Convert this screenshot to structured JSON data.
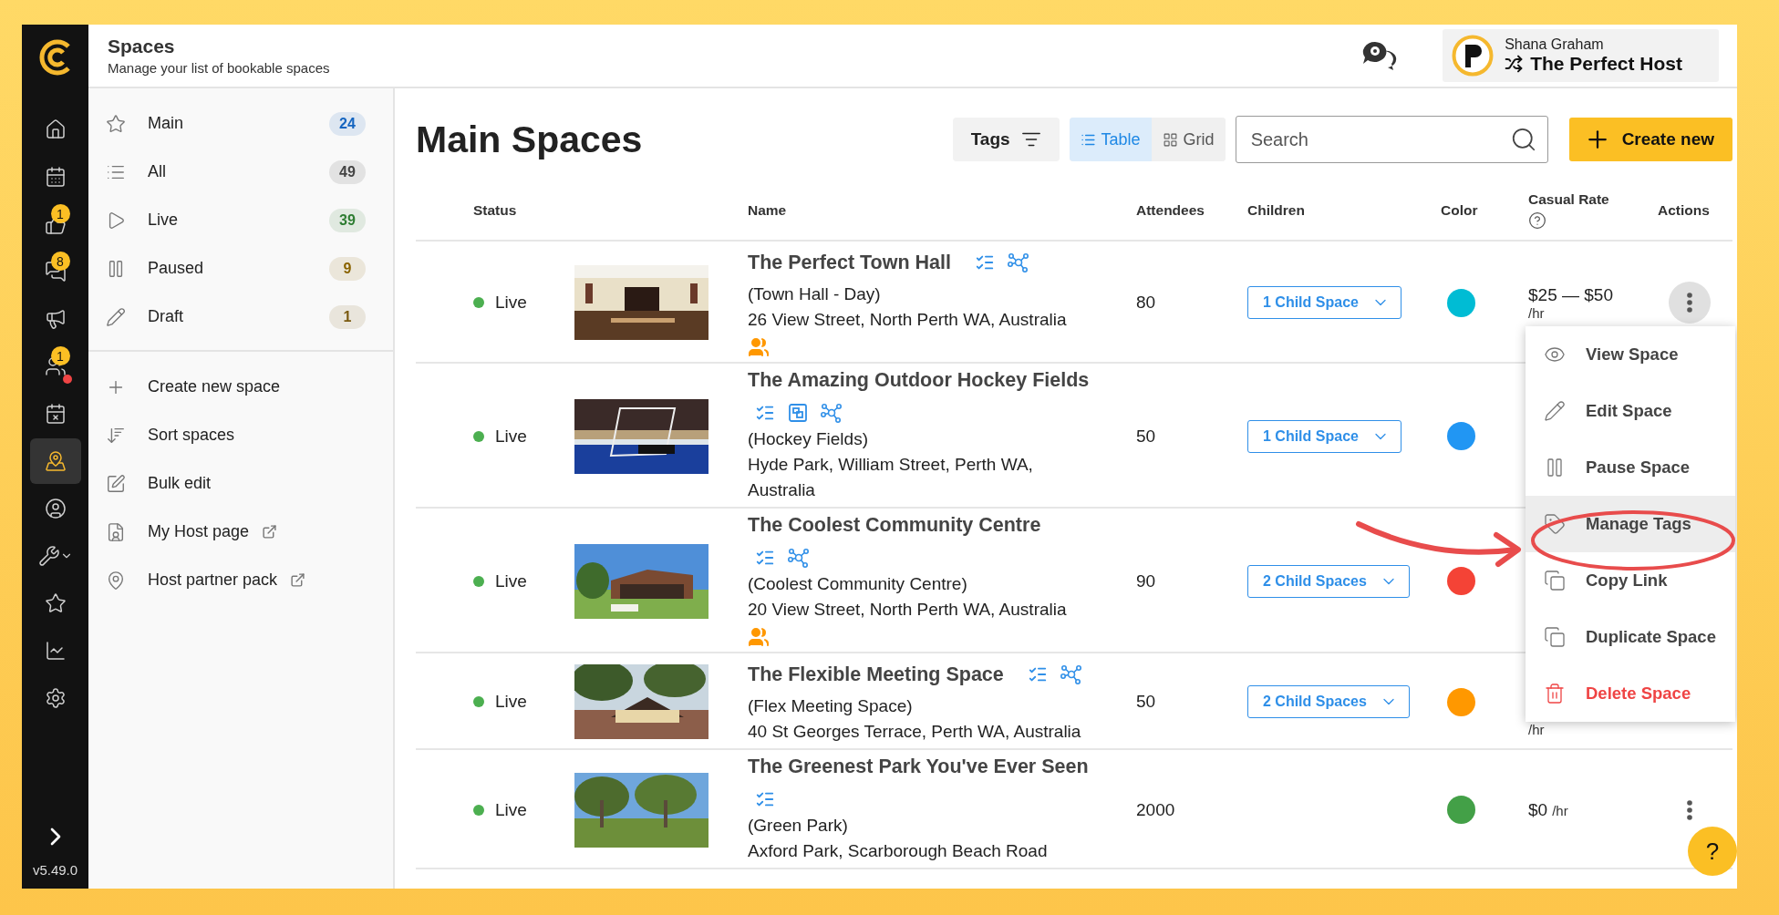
{
  "rail": {
    "items": [
      {
        "selected": false,
        "alert": false
      },
      {
        "selected": false,
        "alert": false
      },
      {
        "selected": false,
        "alert": false,
        "badge": "1"
      },
      {
        "selected": false,
        "alert": false,
        "badge": "8"
      },
      {
        "selected": false,
        "alert": false
      },
      {
        "selected": false,
        "alert": true,
        "badge": "1"
      },
      {
        "selected": false,
        "alert": false
      },
      {
        "selected": true,
        "alert": false
      },
      {
        "selected": false,
        "alert": false
      },
      {
        "selected": false,
        "alert": false
      },
      {
        "selected": false,
        "alert": false
      },
      {
        "selected": false,
        "alert": false
      },
      {
        "selected": false,
        "alert": false
      }
    ],
    "version": "v5.49.0"
  },
  "header": {
    "title": "Spaces",
    "subtitle": "Manage your list of bookable spaces",
    "user": {
      "name": "Shana Graham",
      "organisation": "The Perfect Host"
    }
  },
  "sidebar": {
    "views": [
      {
        "label": "Main",
        "count": "24",
        "color": "#1565c0"
      },
      {
        "label": "All",
        "count": "49",
        "color": "#444444"
      },
      {
        "label": "Live",
        "count": "39",
        "color": "#2e7d32"
      },
      {
        "label": "Paused",
        "count": "9",
        "color": "#8a6300"
      },
      {
        "label": "Draft",
        "count": "1",
        "color": "#7a5a10"
      }
    ],
    "actions": [
      {
        "label": "Create new space",
        "external": false
      },
      {
        "label": "Sort spaces",
        "external": false
      },
      {
        "label": "Bulk edit",
        "external": false
      },
      {
        "label": "My Host page",
        "external": true
      },
      {
        "label": "Host partner pack",
        "external": true
      }
    ]
  },
  "main": {
    "title": "Main Spaces",
    "tags_button": "Tags",
    "view_toggle": [
      {
        "label": "Table",
        "selected": true
      },
      {
        "label": "Grid",
        "selected": false
      }
    ],
    "search": {
      "placeholder": "Search"
    },
    "create_button": "Create new",
    "table": {
      "columns": [
        {
          "label": "Status",
          "help": false
        },
        {
          "label": "Name",
          "help": false
        },
        {
          "label": "Attendees",
          "help": false
        },
        {
          "label": "Children",
          "help": false
        },
        {
          "label": "Color",
          "help": false
        },
        {
          "label": "Casual Rate",
          "help": true
        },
        {
          "label": "Actions",
          "help": false
        }
      ],
      "rows": [
        {
          "status": "Live",
          "picture": {
            "kind": "picture"
          },
          "title": "The Perfect Town Hall",
          "badges": [
            {
              "kind": "checklist"
            },
            {
              "kind": "hub"
            }
          ],
          "alias": "(Town Hall - Day)",
          "address": "26 View Street, North Perth WA, Australia",
          "group": true,
          "attendees": "80",
          "children": "1 Child Space",
          "color": "#00bcd4",
          "rate": "$25 — $50",
          "rate_unit": "/hr",
          "actions": {
            "open": true
          }
        },
        {
          "status": "Live",
          "picture": {
            "kind": "picture"
          },
          "title": "The Amazing Outdoor Hockey Fields",
          "badges": [
            {
              "kind": "checklist"
            },
            {
              "kind": "layout"
            },
            {
              "kind": "hub"
            }
          ],
          "alias": "(Hockey Fields)",
          "address": "Hyde Park, William Street, Perth WA, Australia",
          "group": false,
          "attendees": "50",
          "children": "1 Child Space",
          "color": "#2196f3"
        },
        {
          "status": "Live",
          "picture": {
            "kind": "picture"
          },
          "title": "The Coolest Community Centre",
          "badges": [
            {
              "kind": "checklist"
            },
            {
              "kind": "hub"
            }
          ],
          "alias": "(Coolest Community Centre)",
          "address": "20 View Street, North Perth WA, Australia",
          "group": true,
          "attendees": "90",
          "children": "2 Child Spaces",
          "color": "#f44336"
        },
        {
          "status": "Live",
          "picture": {
            "kind": "picture"
          },
          "title": "The Flexible Meeting Space",
          "badges": [
            {
              "kind": "checklist"
            },
            {
              "kind": "hub"
            }
          ],
          "alias": "(Flex Meeting Space)",
          "address": "40 St Georges Terrace, Perth WA, Australia",
          "group": false,
          "attendees": "50",
          "children": "2 Child Spaces",
          "color": "#ff9800",
          "rate_unit": "/hr"
        },
        {
          "status": "Live",
          "picture": {
            "kind": "picture"
          },
          "title": "The Greenest Park You've Ever Seen",
          "badges": [
            {
              "kind": "checklist"
            }
          ],
          "alias": "(Green Park)",
          "address": "Axford Park, Scarborough Beach Road",
          "group": false,
          "attendees": "2000",
          "color": "#43a047",
          "rate": "$0",
          "rate_unit": "/hr",
          "actions": {
            "open": false
          }
        }
      ]
    },
    "menu": {
      "items": [
        {
          "label": "View Space",
          "highlighted": false,
          "danger": false
        },
        {
          "label": "Edit Space",
          "highlighted": false,
          "danger": false
        },
        {
          "label": "Pause Space",
          "highlighted": false,
          "danger": false
        },
        {
          "label": "Manage Tags",
          "highlighted": true,
          "danger": false
        },
        {
          "label": "Copy Link",
          "highlighted": false,
          "danger": false
        },
        {
          "label": "Duplicate Space",
          "highlighted": false,
          "danger": false
        },
        {
          "label": "Delete Space",
          "highlighted": false,
          "danger": true
        }
      ]
    }
  },
  "help_button": "?"
}
